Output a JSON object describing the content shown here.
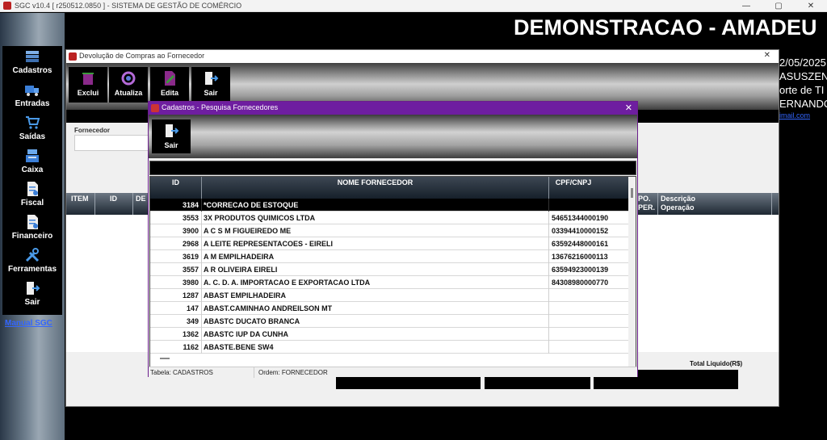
{
  "app": {
    "title": "SGC v10.4 [ r250512.0850 ] - SISTEMA DE GESTÃO DE COMÉRCIO",
    "window_controls": [
      "—",
      "▢",
      "✕"
    ]
  },
  "sidebar": {
    "items": [
      {
        "label": "Cadastros",
        "icon": "database-icon"
      },
      {
        "label": "Entradas",
        "icon": "truck-icon"
      },
      {
        "label": "Saídas",
        "icon": "cart-icon"
      },
      {
        "label": "Caixa",
        "icon": "cash-register-icon"
      },
      {
        "label": "Fiscal",
        "icon": "document-icon"
      },
      {
        "label": "Financeiro",
        "icon": "finance-document-icon"
      },
      {
        "label": "Ferramentas",
        "icon": "tools-icon"
      },
      {
        "label": "Sair",
        "icon": "exit-door-icon"
      }
    ],
    "manual_link": "Manual SGC"
  },
  "background": {
    "banner": "DEMONSTRACAO - AMADEU",
    "lines": [
      "2/05/2025",
      "ASUSZEN",
      "orte de TI",
      "ERNANDO"
    ],
    "link": "imail.com"
  },
  "devolucao": {
    "title": "Devolução de Compras ao Fornecedor",
    "close": "✕",
    "toolbar": [
      {
        "label": "Exclui",
        "icon": "delete-icon"
      },
      {
        "label": "Atualiza",
        "icon": "refresh-icon"
      },
      {
        "label": "Edita",
        "icon": "edit-icon"
      },
      {
        "label": "Sair",
        "icon": "exit-door-icon"
      }
    ],
    "fornecedor_label": "Fornecedor",
    "grid_headers": {
      "item": "ITEM",
      "id": "ID",
      "de": "DE",
      "tipo": "PO.\nPER.",
      "descricao": "Descrição\nOperação"
    },
    "total_label": "Total Liquido(R$)"
  },
  "dialog": {
    "title": "Cadastros - Pesquisa Fornecedores",
    "close": "✕",
    "sair_label": "Sair",
    "columns": [
      "ID",
      "NOME FORNECEDOR",
      "CPF/CNPJ"
    ],
    "rows": [
      {
        "id": "3184",
        "name": "*CORRECAO DE ESTOQUE",
        "cpf": ""
      },
      {
        "id": "3553",
        "name": "3X PRODUTOS QUIMICOS LTDA",
        "cpf": "54651344000190"
      },
      {
        "id": "3900",
        "name": "A C S M FIGUEIREDO ME",
        "cpf": "03394410000152"
      },
      {
        "id": "2968",
        "name": "A LEITE REPRESENTACOES - EIRELI",
        "cpf": "63592448000161"
      },
      {
        "id": "3619",
        "name": "A M EMPILHADEIRA",
        "cpf": "13676216000113"
      },
      {
        "id": "3557",
        "name": "A R OLIVEIRA EIRELI",
        "cpf": "63594923000139"
      },
      {
        "id": "3980",
        "name": "A. C. D. A. IMPORTACAO E EXPORTACAO LTDA",
        "cpf": "84308980000770"
      },
      {
        "id": "1287",
        "name": "ABAST EMPILHADEIRA",
        "cpf": ""
      },
      {
        "id": "147",
        "name": "ABAST.CAMINHAO ANDREILSON MT",
        "cpf": ""
      },
      {
        "id": "349",
        "name": "ABASTC DUCATO BRANCA",
        "cpf": ""
      },
      {
        "id": "1362",
        "name": "ABASTC IUP DA CUNHA",
        "cpf": ""
      },
      {
        "id": "1162",
        "name": "ABASTE.BENE SW4",
        "cpf": ""
      }
    ],
    "status_table": "Tabela: CADASTROS",
    "status_order": "Ordem: FORNECEDOR"
  }
}
